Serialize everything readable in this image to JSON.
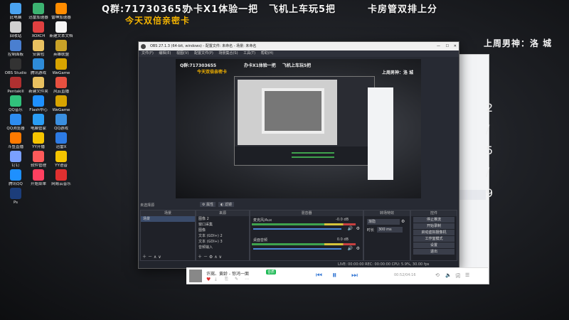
{
  "overlay": {
    "group": "Q群:717303655",
    "offer1": "办卡X1体验一把",
    "offer2": "飞机上车玩5把",
    "offer3": "卡房管双排上分",
    "promo": "今天双倍亲密卡",
    "last_week": "上周男神：洛 城"
  },
  "desktop_icons": [
    {
      "label": "此电脑",
      "color": "#4aa3f0"
    },
    {
      "label": "迅雷加速器",
      "color": "#3cb371"
    },
    {
      "label": "雷神加速器",
      "color": "#ff8c00"
    },
    {
      "label": "回收站",
      "color": "#d0d0d0"
    },
    {
      "label": "XOXCH",
      "color": "#e04040"
    },
    {
      "label": "新建文本文档",
      "color": "#f5f5f5"
    },
    {
      "label": "控制面板",
      "color": "#4a7fd0"
    },
    {
      "label": "安装包",
      "color": "#e8c060"
    },
    {
      "label": "英雄联盟",
      "color": "#c9a227"
    },
    {
      "label": "OBS Studio",
      "color": "#333"
    },
    {
      "label": "腾讯游戏",
      "color": "#2e8bd8"
    },
    {
      "label": "WeGame",
      "color": "#d8a400"
    },
    {
      "label": "Pentakill",
      "color": "#b03030"
    },
    {
      "label": "新建文件夹",
      "color": "#e8c060"
    },
    {
      "label": "风云直播",
      "color": "#e85040"
    },
    {
      "label": "QQ音乐",
      "color": "#31c27c"
    },
    {
      "label": "Flash中心",
      "color": "#1e90ff"
    },
    {
      "label": "WeGame",
      "color": "#d8a400"
    },
    {
      "label": "QQ浏览器",
      "color": "#2d8cf0"
    },
    {
      "label": "电脑管家",
      "color": "#2a9df4"
    },
    {
      "label": "QQ游戏",
      "color": "#3a8fe0"
    },
    {
      "label": "斗鱼直播",
      "color": "#ff7a00"
    },
    {
      "label": "YY开播",
      "color": "#f5c400"
    },
    {
      "label": "迅雷X",
      "color": "#2d7be5"
    },
    {
      "label": "钉钉",
      "color": "#7aa0ff"
    },
    {
      "label": "软件管理",
      "color": "#ff5a5a"
    },
    {
      "label": "YY语音",
      "color": "#f5c400"
    },
    {
      "label": "腾讯QQ",
      "color": "#1e90ff"
    },
    {
      "label": "开始菜单",
      "color": "#ff4060"
    },
    {
      "label": "网易云音乐",
      "color": "#e03030"
    },
    {
      "label": "Ps",
      "color": "#1c3d7a"
    }
  ],
  "obs": {
    "title": "OBS 27.1.3 (64-bit, windows) - 配置文件: 未命名 - 场景: 未命名",
    "menu": [
      "文件(F)",
      "编辑(E)",
      "视图(V)",
      "配置文件(P)",
      "场景集合(S)",
      "工具(T)",
      "帮助(H)"
    ],
    "source_hint": "未选择源",
    "props_btn": "属性",
    "filter_btn": "滤镜",
    "scenes_head": "场景",
    "scenes": [
      "场景"
    ],
    "sources_head": "来源",
    "sources": [
      "图像 2",
      "窗口采集",
      "图像",
      "文本 (GDI+) 2",
      "文本 (GDI+) 3",
      "音频输入"
    ],
    "mixer_head": "混音器",
    "mixer": [
      {
        "name": "麦克风/Aux",
        "db": "-0.0 dB"
      },
      {
        "name": "桌面音频",
        "db": "0.0 dB"
      }
    ],
    "transitions_head": "转场特效",
    "transition_type": "渐隐",
    "duration_label": "时长",
    "duration_value": "300 ms",
    "controls_head": "控件",
    "controls": [
      "停止推流",
      "开始录制",
      "启动虚拟摄像机",
      "工作室模式",
      "设置",
      "退出"
    ],
    "status": "LIVE: 00:00:00   REC: 00:00:00   CPU: 5.9%, 30.00 fps"
  },
  "music": {
    "song": "许嵩、黄龄 - 惊鸿一面",
    "tag": "音质",
    "time": "00:52/04:16"
  },
  "side_chars": [
    "2",
    "/",
    "5",
    "/",
    "9"
  ]
}
